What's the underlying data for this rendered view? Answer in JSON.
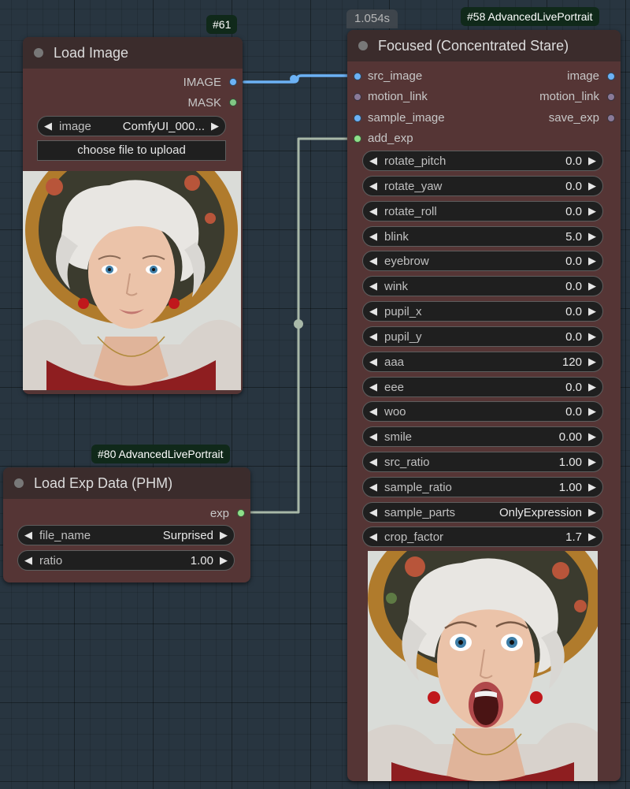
{
  "timer": {
    "text": "1.054s"
  },
  "node61": {
    "badge": "#61",
    "title": "Load Image",
    "outputs": [
      {
        "label": "IMAGE",
        "color": "#6cb2f5"
      },
      {
        "label": "MASK",
        "color": "#81c784"
      }
    ],
    "image_widget": {
      "label": "image",
      "value": "ComfyUI_000..."
    },
    "upload_label": "choose file to upload"
  },
  "node80": {
    "badge": "#80 AdvancedLivePortrait",
    "title": "Load Exp Data (PHM)",
    "output": {
      "label": "exp",
      "color": "#8ee08a"
    },
    "widgets": [
      {
        "label": "file_name",
        "value": "Surprised"
      },
      {
        "label": "ratio",
        "value": "1.00"
      }
    ]
  },
  "node58": {
    "badge": "#58 AdvancedLivePortrait",
    "title": "Focused (Concentrated Stare)",
    "inputs": [
      {
        "label": "src_image",
        "color": "#6cb2f5"
      },
      {
        "label": "motion_link",
        "color": "#8a7a98"
      },
      {
        "label": "sample_image",
        "color": "#6cb2f5"
      },
      {
        "label": "add_exp",
        "color": "#8ee08a"
      }
    ],
    "outputs": [
      {
        "label": "image",
        "color": "#6cb2f5"
      },
      {
        "label": "motion_link",
        "color": "#8a7a98"
      },
      {
        "label": "save_exp",
        "color": "#8a7a98"
      }
    ],
    "widgets": [
      {
        "label": "rotate_pitch",
        "value": "0.0"
      },
      {
        "label": "rotate_yaw",
        "value": "0.0"
      },
      {
        "label": "rotate_roll",
        "value": "0.0"
      },
      {
        "label": "blink",
        "value": "5.0"
      },
      {
        "label": "eyebrow",
        "value": "0.0"
      },
      {
        "label": "wink",
        "value": "0.0"
      },
      {
        "label": "pupil_x",
        "value": "0.0"
      },
      {
        "label": "pupil_y",
        "value": "0.0"
      },
      {
        "label": "aaa",
        "value": "120"
      },
      {
        "label": "eee",
        "value": "0.0"
      },
      {
        "label": "woo",
        "value": "0.0"
      },
      {
        "label": "smile",
        "value": "0.00"
      },
      {
        "label": "src_ratio",
        "value": "1.00"
      },
      {
        "label": "sample_ratio",
        "value": "1.00"
      },
      {
        "label": "sample_parts",
        "value": "OnlyExpression"
      },
      {
        "label": "crop_factor",
        "value": "1.7"
      }
    ]
  },
  "links": {
    "image_color": "#6cb2f5",
    "exp_color": "#a8b8a8"
  }
}
